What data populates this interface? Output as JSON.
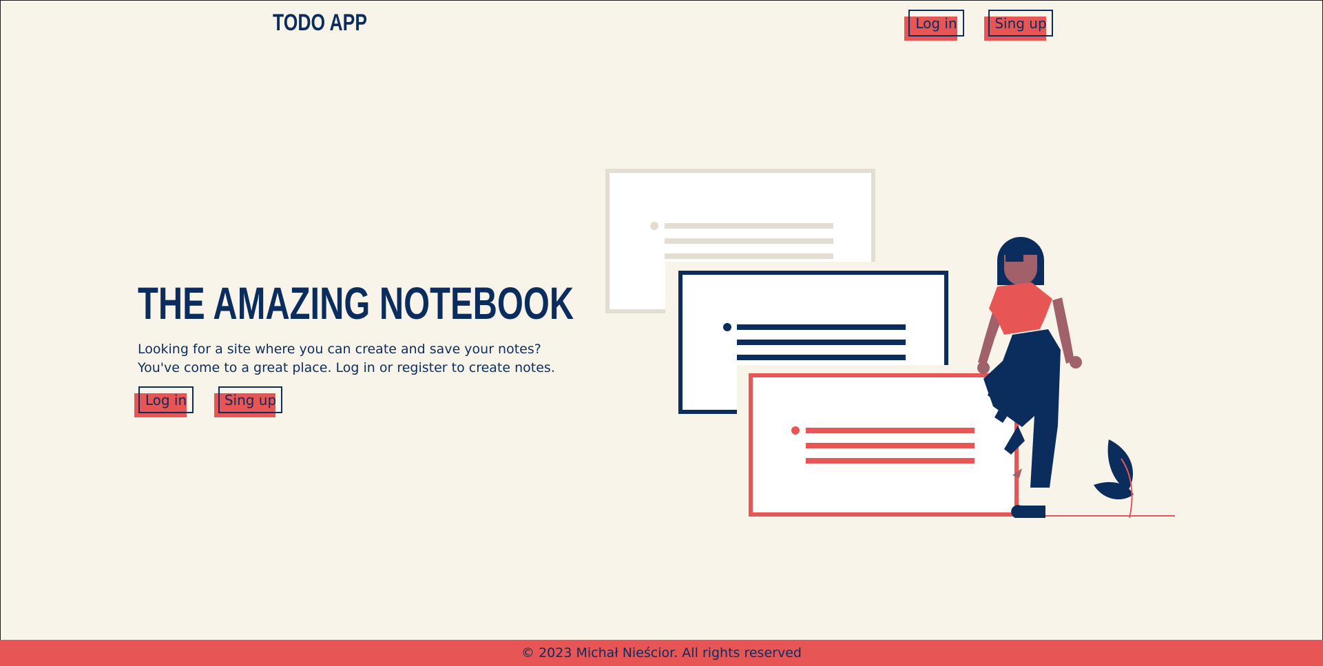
{
  "header": {
    "brand": "TODO APP",
    "login_label": "Log in",
    "signup_label": "Sing up"
  },
  "hero": {
    "title": "THE AMAZING NOTEBOOK",
    "line1": "Looking for a site where you can create and save your notes?",
    "line2": "You've come to a great place. Log in or register to create notes.",
    "login_label": "Log in",
    "signup_label": "Sing up"
  },
  "footer": {
    "text": "© 2023 Michał Nieścior. All rights reserved"
  },
  "colors": {
    "background": "#f9f4ea",
    "navy": "#0b2d5e",
    "accent": "#e85555",
    "beige": "#e4ddd1"
  }
}
